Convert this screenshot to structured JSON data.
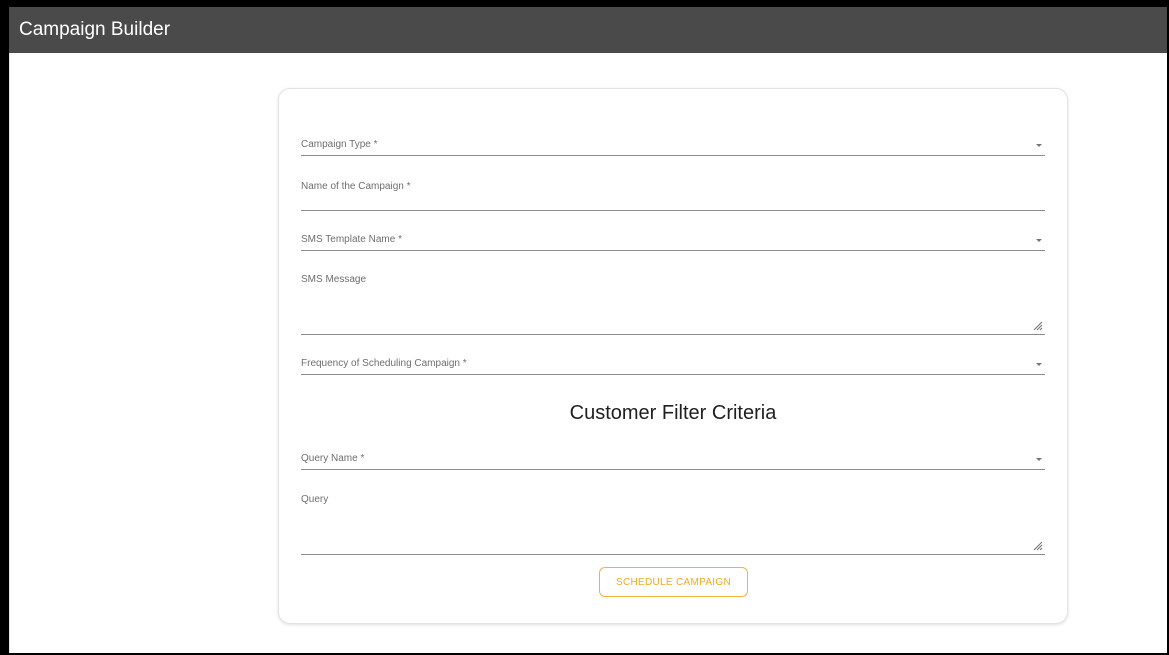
{
  "app": {
    "title": "Campaign Builder"
  },
  "form": {
    "campaign_type": {
      "label": "Campaign Type *",
      "value": ""
    },
    "campaign_name": {
      "label": "Name of the Campaign *",
      "value": ""
    },
    "sms_template": {
      "label": "SMS Template Name *",
      "value": ""
    },
    "sms_message": {
      "label": "SMS Message",
      "value": ""
    },
    "frequency": {
      "label": "Frequency of Scheduling Campaign *",
      "value": ""
    },
    "section_title": "Customer Filter Criteria",
    "query_name": {
      "label": "Query Name *",
      "value": ""
    },
    "query": {
      "label": "Query",
      "value": ""
    },
    "submit_label": "SCHEDULE CAMPAIGN"
  },
  "icons": {
    "dropdown": "caret-down-icon",
    "resize": "resize-handle-icon"
  },
  "colors": {
    "titlebar": "#4a4a4a",
    "accent": "#f0a920"
  }
}
